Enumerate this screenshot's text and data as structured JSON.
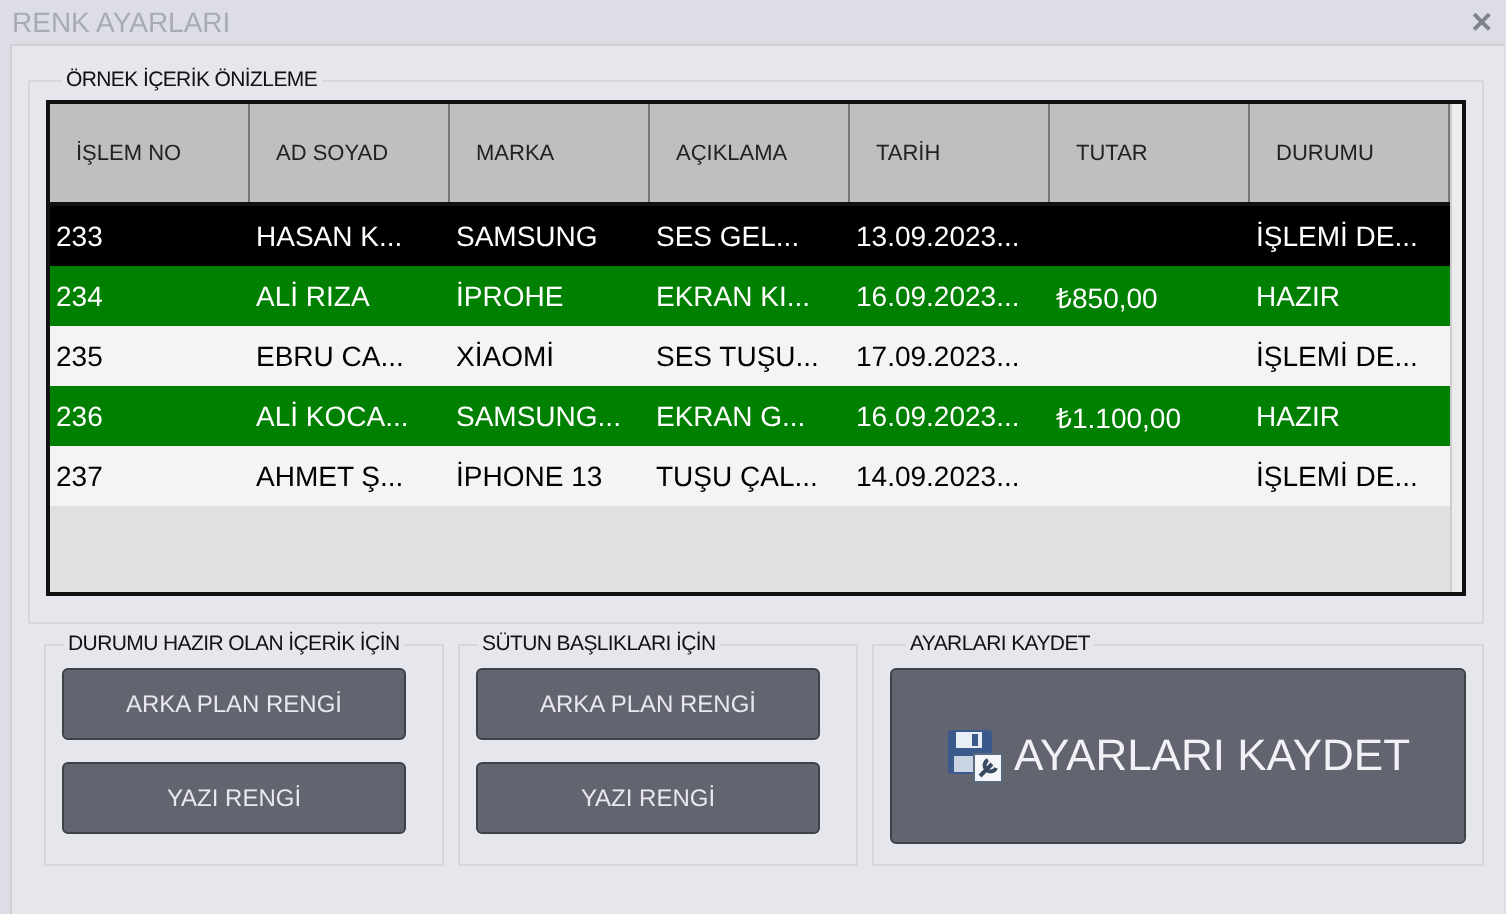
{
  "window": {
    "title": "RENK AYARLARI",
    "close": "✕"
  },
  "preview": {
    "title": "ÖRNEK İÇERİK ÖNİZLEME",
    "table": {
      "columns": [
        "İŞLEM NO",
        "AD SOYAD",
        "MARKA",
        "AÇIKLAMA",
        "TARİH",
        "TUTAR",
        "DURUMU"
      ],
      "rows": [
        {
          "kind": "dark",
          "cells": {
            "0": "233",
            "1": "HASAN K...",
            "2": "SAMSUNG",
            "3": "SES GEL...",
            "4": "13.09.2023...",
            "6": "İŞLEMİ DE..."
          }
        },
        {
          "kind": "ready",
          "cells": {
            "0": "234",
            "1": "ALİ RIZA",
            "2": "İPROHE",
            "3": "EKRAN KI...",
            "4": "16.09.2023...",
            "5": "₺850,00",
            "6": "HAZIR"
          }
        },
        {
          "kind": "normal",
          "cells": {
            "0": "235",
            "1": "EBRU CA...",
            "2": "XİAOMİ",
            "3": "SES TUŞU...",
            "4": "17.09.2023...",
            "6": "İŞLEMİ DE..."
          }
        },
        {
          "kind": "ready",
          "cells": {
            "0": "236",
            "1": "ALİ KOCA...",
            "2": "SAMSUNG...",
            "3": "EKRAN G...",
            "4": "16.09.2023...",
            "5": "₺1.100,00",
            "6": "HAZIR"
          }
        },
        {
          "kind": "normal",
          "cells": {
            "0": "237",
            "1": "AHMET Ş...",
            "2": "İPHONE 13",
            "3": "TUŞU ÇAL...",
            "4": "14.09.2023...",
            "6": "İŞLEMİ DE..."
          }
        }
      ]
    }
  },
  "groups": [
    {
      "title": "DURUMU HAZIR OLAN İÇERİK İÇİN",
      "buttons": [
        "ARKA PLAN RENGİ",
        "YAZI RENGİ"
      ]
    },
    {
      "title": "SÜTUN BAŞLIKLARI İÇİN",
      "buttons": [
        "ARKA PLAN RENGİ",
        "YAZI RENGİ"
      ]
    }
  ],
  "save": {
    "title": "AYARLARI KAYDET",
    "button": "AYARLARI KAYDET"
  }
}
